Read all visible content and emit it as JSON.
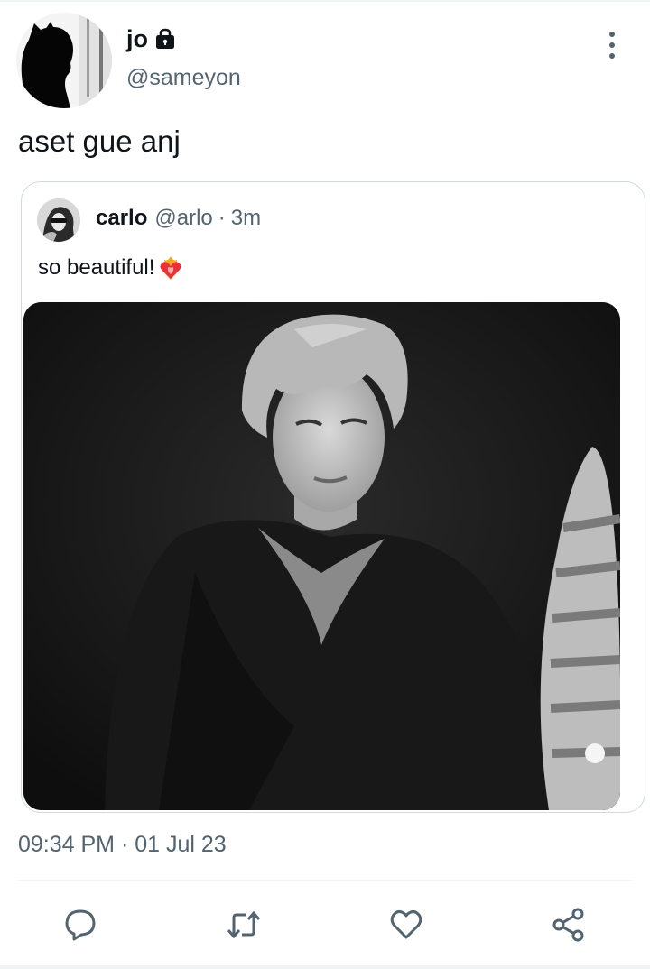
{
  "author": {
    "display_name": "jo",
    "handle": "@sameyon",
    "protected_icon": "lock-icon",
    "avatar_icon": "silhouette-avatar"
  },
  "tweet": {
    "text": "aset gue anj",
    "timestamp": "09:34 PM · 01 Jul 23"
  },
  "quote": {
    "display_name": "carlo",
    "handle": "@arlo",
    "separator": "·",
    "time": "3m",
    "text": "so beautiful!",
    "emoji": "heart-on-fire-emoji",
    "media": "black-and-white-portrait-photo"
  },
  "menu_icon": "more-vertical-icon",
  "actions": [
    {
      "name": "reply",
      "icon": "reply-icon"
    },
    {
      "name": "retweet",
      "icon": "retweet-icon"
    },
    {
      "name": "like",
      "icon": "heart-icon"
    },
    {
      "name": "share",
      "icon": "share-icon"
    }
  ],
  "colors": {
    "text_primary": "#0f1419",
    "text_secondary": "#536471",
    "border": "#cfd9de",
    "divider": "#eff3f4",
    "icon": "#536471"
  }
}
